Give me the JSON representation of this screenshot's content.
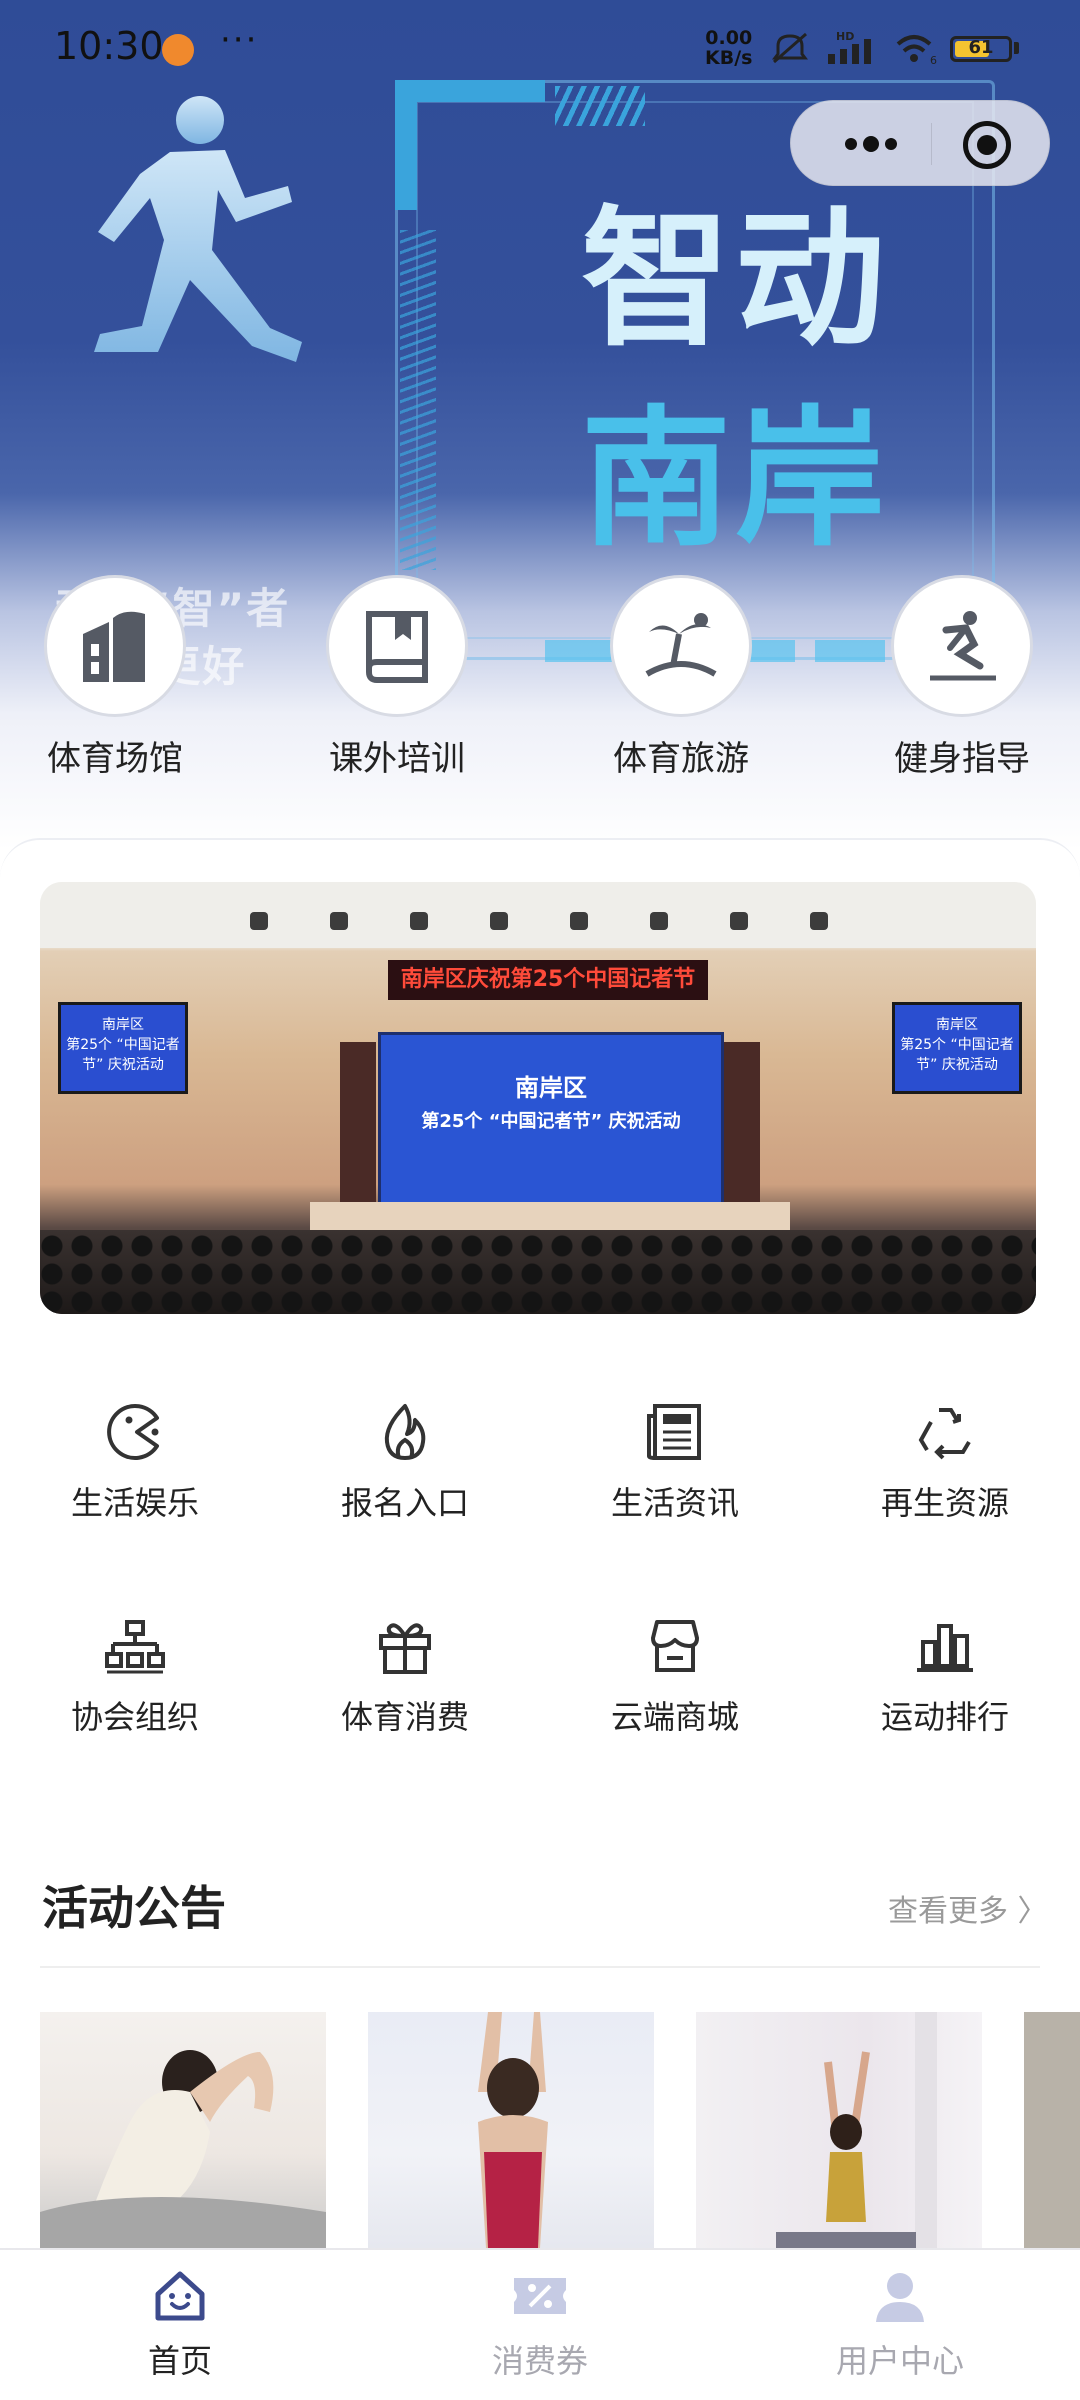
{
  "status_bar": {
    "time": "10:30",
    "more": "···",
    "net_speed_value": "0.00",
    "net_speed_unit": "KB/s",
    "signal_label": "HD",
    "wifi_label": "6",
    "battery": "61",
    "battery_level": 0.61
  },
  "hero": {
    "title_line1": "智动",
    "title_line2": "南岸",
    "slogan_line1": "动，“智”者",
    "slogan_line2": "“健”更好",
    "accent_color": "#49c0ea",
    "background_color": "#2f4c97"
  },
  "capsule": {
    "more_icon": "more-dots-icon",
    "close_icon": "target-icon"
  },
  "categories": [
    {
      "label": "体育场馆",
      "icon": "building-icon"
    },
    {
      "label": "课外培训",
      "icon": "book-icon"
    },
    {
      "label": "体育旅游",
      "icon": "island-icon"
    },
    {
      "label": "健身指导",
      "icon": "skier-icon"
    }
  ],
  "banner": {
    "stage_banner": "南岸区庆祝第25个中国记者节",
    "screen_line1": "南岸区",
    "screen_line2": "第25个 “中国记者节” 庆祝活动",
    "side_screen_line1": "南岸区",
    "side_screen_line2": "第25个 “中国记者节” 庆祝活动"
  },
  "grid": [
    {
      "label": "生活娱乐",
      "icon": "pacman-icon"
    },
    {
      "label": "报名入口",
      "icon": "flame-icon"
    },
    {
      "label": "生活资讯",
      "icon": "newspaper-icon"
    },
    {
      "label": "再生资源",
      "icon": "recycle-icon"
    },
    {
      "label": "协会组织",
      "icon": "org-chart-icon"
    },
    {
      "label": "体育消费",
      "icon": "gift-icon"
    },
    {
      "label": "云端商城",
      "icon": "store-icon"
    },
    {
      "label": "运动排行",
      "icon": "bar-rank-icon"
    }
  ],
  "activity": {
    "title": "活动公告",
    "more": "查看更多 〉"
  },
  "tabbar": [
    {
      "label": "首页",
      "icon": "home-icon",
      "active": true
    },
    {
      "label": "消费券",
      "icon": "coupon-icon",
      "active": false
    },
    {
      "label": "用户中心",
      "icon": "user-icon",
      "active": false
    }
  ]
}
